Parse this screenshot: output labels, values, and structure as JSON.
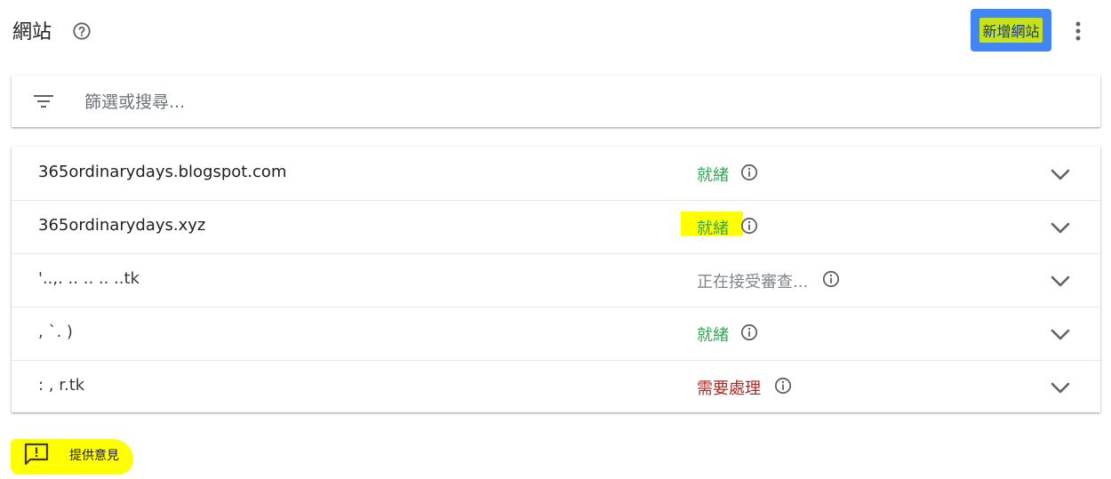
{
  "header": {
    "title": "網站",
    "add_site_label": "新增網站"
  },
  "search": {
    "placeholder": "篩選或搜尋..."
  },
  "sites": [
    {
      "name": "365ordinarydays.blogspot.com",
      "status": "就緒"
    },
    {
      "name": "365ordinarydays.xyz",
      "status": "就緒"
    },
    {
      "name": "'..,. ..  ..  .. ..tk",
      "status": "正在接受審查..."
    },
    {
      "name": ",              `.  )",
      "status": "就緒"
    },
    {
      "name": ":    ,    r.tk",
      "status": "需要處理"
    }
  ],
  "footer": {
    "feedback_label": "提供意見"
  }
}
